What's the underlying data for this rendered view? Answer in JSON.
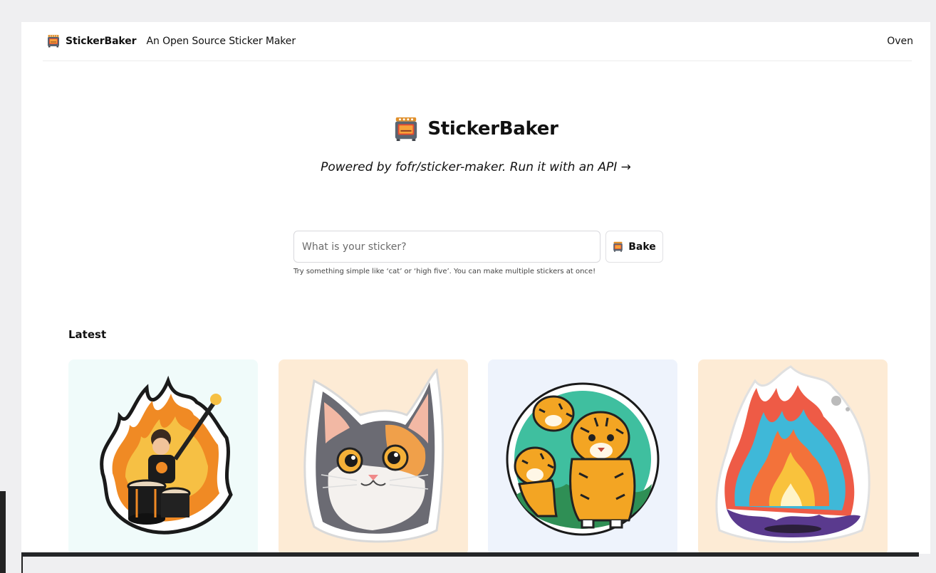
{
  "nav": {
    "brand_name": "StickerBaker",
    "tagline": "An Open Source Sticker Maker",
    "oven_link": "Oven",
    "logo_icon": "oven-icon"
  },
  "hero": {
    "title": "StickerBaker",
    "subtitle": "Powered by fofr/sticker-maker. Run it with an API →",
    "logo_icon": "oven-icon"
  },
  "form": {
    "placeholder": "What is your sticker?",
    "value": "",
    "bake_label": "Bake",
    "bake_icon": "oven-icon",
    "hint": "Try something simple like ‘cat’ or ‘high five’. You can make multiple stickers at once!"
  },
  "latest": {
    "title": "Latest",
    "cards": [
      {
        "image": "fire-drummer-guitarist-sticker",
        "background": "#f0fbfa"
      },
      {
        "image": "calico-cat-sticker",
        "background": "#fdebd5"
      },
      {
        "image": "tigers-sticker",
        "background": "#eef3fc"
      },
      {
        "image": "flame-sticker",
        "background": "#fdebd5"
      }
    ]
  },
  "colors": {
    "page_background": "#efeff1",
    "window_background": "#ffffff",
    "text": "#111111"
  }
}
